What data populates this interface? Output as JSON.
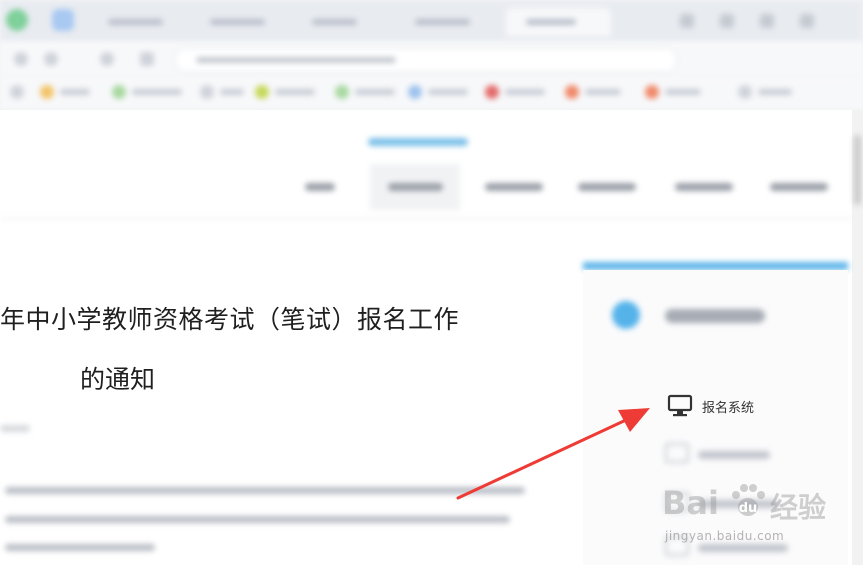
{
  "article": {
    "title_line1": "年中小学教师资格考试（笔试）报名工作",
    "title_line2": "的通知"
  },
  "sidebar": {
    "register_system_label": "报名系统"
  },
  "watermark": {
    "brand_text": "Bai",
    "brand_text_tail": "经验",
    "url": "jingyan.baidu.com"
  },
  "colors": {
    "accent_blue": "#55b3ea",
    "arrow_red": "#ee3b36"
  },
  "icons": {
    "register_system": "monitor-icon",
    "pointer": "red-arrow-annotation"
  }
}
